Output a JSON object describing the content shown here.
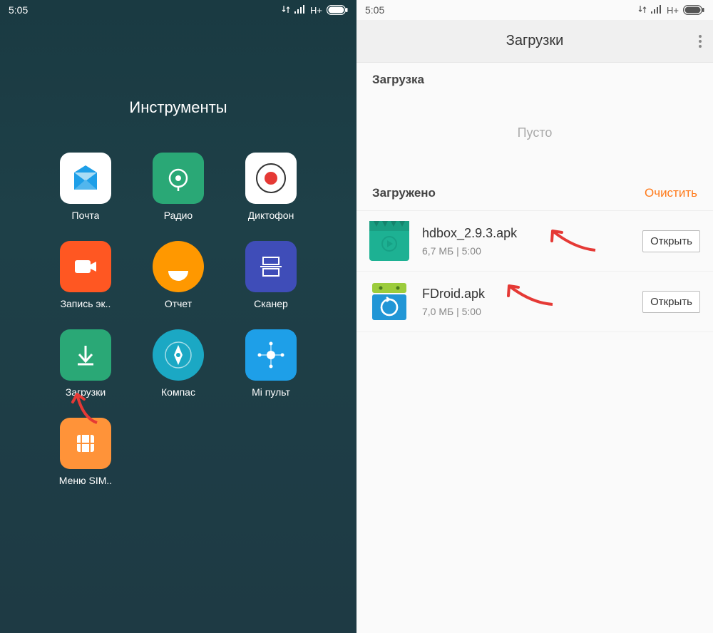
{
  "status": {
    "time": "5:05",
    "net": "H+"
  },
  "left": {
    "folder_title": "Инструменты",
    "apps": [
      {
        "name": "mail",
        "label": "Почта"
      },
      {
        "name": "radio",
        "label": "Радио"
      },
      {
        "name": "recorder",
        "label": "Диктофон"
      },
      {
        "name": "screenrec",
        "label": "Запись эк.."
      },
      {
        "name": "report",
        "label": "Отчет"
      },
      {
        "name": "scanner",
        "label": "Сканер"
      },
      {
        "name": "downloads",
        "label": "Загрузки"
      },
      {
        "name": "compass",
        "label": "Компас"
      },
      {
        "name": "miremote",
        "label": "Mi пульт"
      },
      {
        "name": "sim",
        "label": "Меню SIM.."
      }
    ]
  },
  "right": {
    "title": "Загрузки",
    "section_downloading": "Загрузка",
    "empty": "Пусто",
    "section_downloaded": "Загружено",
    "clear": "Очистить",
    "open": "Открыть",
    "items": [
      {
        "file": "hdbox_2.9.3.apk",
        "meta": "6,7 МБ | 5:00",
        "thumb": "hdbox"
      },
      {
        "file": "FDroid.apk",
        "meta": "7,0 МБ | 5:00",
        "thumb": "fdroid"
      }
    ]
  },
  "colors": {
    "accent": "#ff7a1a"
  }
}
